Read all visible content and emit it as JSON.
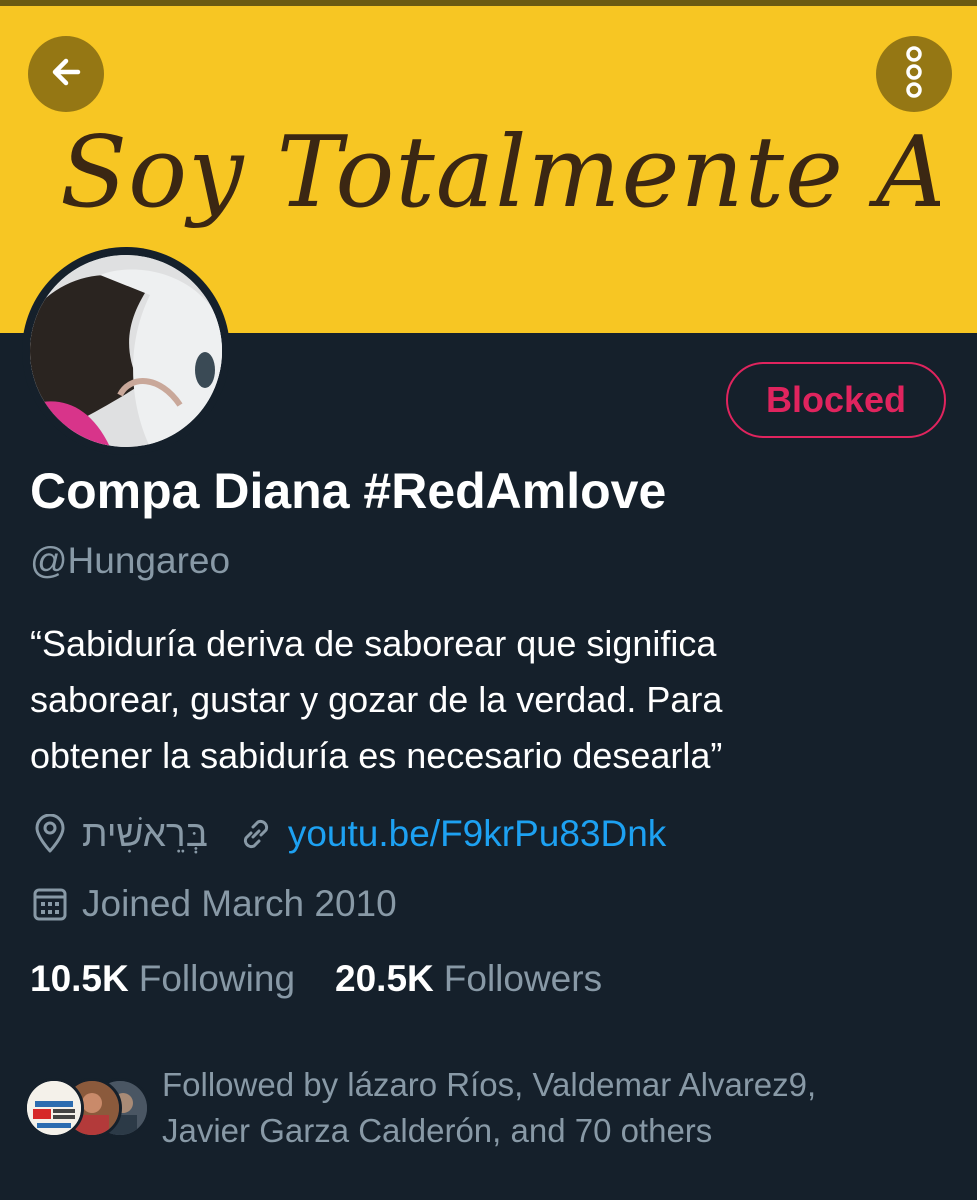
{
  "banner": {
    "text": "Soy Totalmente Amlo"
  },
  "header": {
    "back_icon": "arrow-left-icon",
    "more_icon": "more-vertical-icon"
  },
  "profile": {
    "blocked_label": "Blocked",
    "display_name": "Compa Diana #RedAmlove",
    "handle": "@Hungareo",
    "bio_lines": [
      "“Sabiduría deriva de saborear que significa",
      "saborear, gustar y gozar de la verdad. Para",
      "obtener la sabiduría es necesario desearla”"
    ],
    "location": "בְּרֵאשִׁית",
    "link": "youtu.be/F9krPu83Dnk",
    "joined": "Joined March 2010",
    "following_count": "10.5K",
    "following_label": "Following",
    "followers_count": "20.5K",
    "followers_label": "Followers",
    "followed_by_lines": [
      "Followed by lázaro Ríos, Valdemar Alvarez9,",
      "Javier Garza Calderón, and 70 others"
    ]
  },
  "colors": {
    "background": "#15202b",
    "banner": "#f7c623",
    "blocked": "#e0245e",
    "link": "#1da1f2",
    "secondary_text": "#8899a6"
  }
}
